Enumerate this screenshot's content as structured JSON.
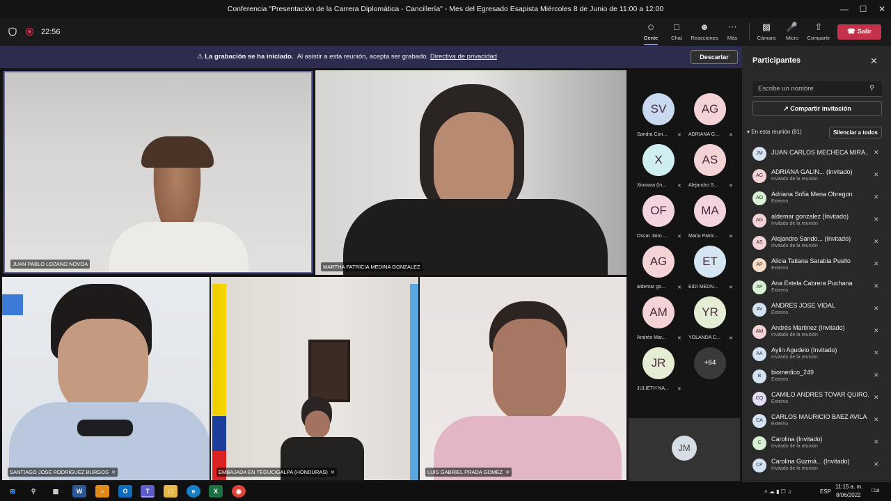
{
  "window": {
    "title": "Conferencia \"Presentación de la Carrera Diplomática - Cancillería\" - Mes del Egresado Esapista Miércoles 8 de Junio de 11:00 a 12:00",
    "minimize": "—",
    "maximize": "☐",
    "close": "✕"
  },
  "toolbar": {
    "timer": "22:56",
    "people": "Gente",
    "chat": "Chat",
    "reactions": "Reacciones",
    "more": "Más",
    "camera": "Cámara",
    "mic": "Micro",
    "share": "Compartir",
    "leave": "Salir"
  },
  "banner": {
    "bold": "La grabación se ha iniciado.",
    "text": "Al asistir a esta reunión, acepta ser grabado.",
    "link": "Directiva de privacidad",
    "dismiss": "Descartar"
  },
  "videos": [
    {
      "name": "JUAN PABLO LOZANO NOVOA",
      "muted": false
    },
    {
      "name": "MARTHA PATRICIA MEDINA GONZALEZ",
      "muted": false
    },
    {
      "name": "SANTIAGO JOSE RODRIGUEZ BURGOS",
      "muted": true
    },
    {
      "name": "EMBAJADA EN TEGUCIGALPA (HONDURAS)",
      "muted": true
    },
    {
      "name": "LUIS GABRIEL PRADA GOMEZ",
      "muted": true
    }
  ],
  "gallery": [
    {
      "initials": "SV",
      "name": "Sandra Con...",
      "color": "#c9d9f0"
    },
    {
      "initials": "AG",
      "name": "ADRIANA G...",
      "color": "#f4d3d6"
    },
    {
      "initials": "X",
      "name": "Xiomara (In...",
      "color": "#cfeef0"
    },
    {
      "initials": "AS",
      "name": "Alejandro S...",
      "color": "#f4d3d6"
    },
    {
      "initials": "OF",
      "name": "Oscar Jairo ...",
      "color": "#f4d3e0"
    },
    {
      "initials": "MA",
      "name": "Maria Patric...",
      "color": "#f4d3e0"
    },
    {
      "initials": "AG",
      "name": "aldemar go...",
      "color": "#f4d3d6"
    },
    {
      "initials": "ET",
      "name": "EIDI MEDN...",
      "color": "#d4e6f1"
    },
    {
      "initials": "AM",
      "name": "Andrés Mar...",
      "color": "#f4d3d6"
    },
    {
      "initials": "YR",
      "name": "YOLANDA C...",
      "color": "#e4edd4"
    },
    {
      "initials": "JR",
      "name": "JULIETH NA...",
      "color": "#e4edd4"
    },
    {
      "initials": "+64",
      "name": "",
      "color": "#3a3a3a"
    }
  ],
  "self_view": {
    "initials": "JM"
  },
  "panel": {
    "title": "Participantes",
    "search_placeholder": "Escribe un nombre",
    "invite": "Compartir invitación",
    "in_meeting": "En esta reunión (81)",
    "mute_all": "Silenciar a todos",
    "participants": [
      {
        "initials": "JM",
        "name": "JUAN CARLOS MECHECA MIRA...",
        "sub": "",
        "color": "#d7e3ef"
      },
      {
        "initials": "AG",
        "name": "ADRIANA GALIN... (Invitado)",
        "sub": "Invitado de la reunión",
        "color": "#f4d3d6"
      },
      {
        "initials": "AO",
        "name": "Adriana Sofia Mena Obregon",
        "sub": "Externo",
        "color": "#d8f0d4"
      },
      {
        "initials": "AG",
        "name": "aldemar gonzalez (Invitado)",
        "sub": "Invitado de la reunión",
        "color": "#f4d3d6"
      },
      {
        "initials": "AS",
        "name": "Alejandro Sando... (Invitado)",
        "sub": "Invitado de la reunión",
        "color": "#f4d3d6"
      },
      {
        "initials": "AP",
        "name": "Alicia Tatiana Sarabia Puello",
        "sub": "Externo",
        "color": "#f8dcc8"
      },
      {
        "initials": "AP",
        "name": "Ana Estela Cabrera Puchana",
        "sub": "Externo",
        "color": "#d8f0d4"
      },
      {
        "initials": "AV",
        "name": "ANDRES JOSE VIDAL",
        "sub": "Externo",
        "color": "#d4e3f4"
      },
      {
        "initials": "AM",
        "name": "Andrés Martinez (Invitado)",
        "sub": "Invitado de la reunión",
        "color": "#f4d3d6"
      },
      {
        "initials": "AA",
        "name": "Aylin Agudelo (Invitado)",
        "sub": "Invitado de la reunión",
        "color": "#d4e3f4"
      },
      {
        "initials": "B",
        "name": "biomedico_249",
        "sub": "Externo",
        "color": "#d4e3f4"
      },
      {
        "initials": "CQ",
        "name": "CAMILO ANDRES TOVAR QUIRO...",
        "sub": "Externo",
        "color": "#e6dcf4"
      },
      {
        "initials": "CA",
        "name": "CARLOS MAURICIO BAEZ AVILA",
        "sub": "Externo",
        "color": "#d4e3f4"
      },
      {
        "initials": "C",
        "name": "Carolina (Invitado)",
        "sub": "Invitado de la reunión",
        "color": "#d8f0d4"
      },
      {
        "initials": "CP",
        "name": "Carolina Guzmá... (Invitado)",
        "sub": "Invitado de la reunión",
        "color": "#d4e3f4"
      }
    ]
  },
  "taskbar": {
    "time": "11:15 a. m.",
    "date": "8/06/2022",
    "lang": "ESP",
    "notifications": "18"
  }
}
